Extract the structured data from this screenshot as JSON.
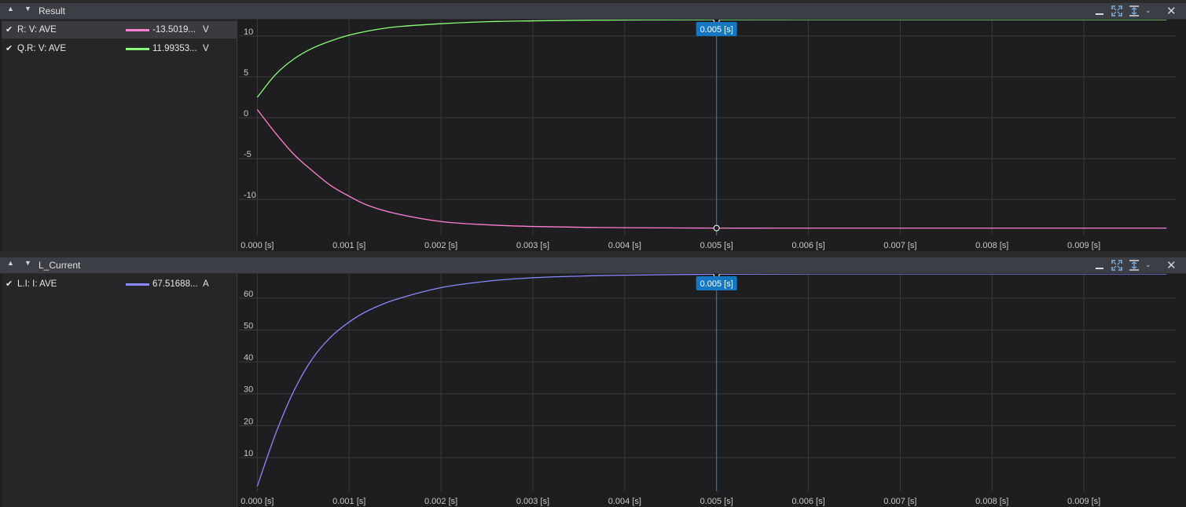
{
  "panels": [
    {
      "title": "Result",
      "legend": [
        {
          "check": "✔",
          "name": "R: V: AVE",
          "value": "-13.5019...",
          "unit": "V",
          "color": "#ff7fd0",
          "selected": true
        },
        {
          "check": "✔",
          "name": "Q.R: V: AVE",
          "value": "11.99353...",
          "unit": "V",
          "color": "#88ff77",
          "selected": false
        }
      ],
      "cursor_label": "0.005 [s]"
    },
    {
      "title": "L_Current",
      "legend": [
        {
          "check": "✔",
          "name": "L.I: I: AVE",
          "value": "67.51688...",
          "unit": "A",
          "color": "#8888ff",
          "selected": false
        }
      ],
      "cursor_label": "0.005 [s]"
    }
  ],
  "colors": {
    "background": "#1e1e20",
    "grid": "#3a3a3e",
    "cursor": "#1e82d2",
    "cursor_label_bg": "#1577c2"
  },
  "chart_data": [
    {
      "type": "line",
      "title": "Result",
      "x_tick_labels": [
        "0.000 [s]",
        "0.001 [s]",
        "0.002 [s]",
        "0.003 [s]",
        "0.004 [s]",
        "0.005 [s]",
        "0.006 [s]",
        "0.007 [s]",
        "0.008 [s]",
        "0.009 [s]"
      ],
      "x_ticks": [
        0,
        0.001,
        0.002,
        0.003,
        0.004,
        0.005,
        0.006,
        0.007,
        0.008,
        0.009
      ],
      "xlim": [
        -0.0002,
        0.01
      ],
      "y_ticks": [
        10,
        5,
        0,
        -5,
        -10
      ],
      "ylim": [
        -14.4,
        12.0
      ],
      "cursor_x": 0.005,
      "series": [
        {
          "name": "R: V: AVE",
          "color": "#ff7fd0",
          "x": [
            0,
            0.0002,
            0.0004,
            0.0006,
            0.0008,
            0.001,
            0.0012,
            0.0015,
            0.002,
            0.0025,
            0.003,
            0.0035,
            0.004,
            0.005,
            0.006,
            0.007,
            0.008,
            0.009,
            0.0099
          ],
          "y": [
            1.0,
            -1.9,
            -4.5,
            -6.5,
            -8.3,
            -9.6,
            -10.7,
            -11.7,
            -12.7,
            -13.1,
            -13.3,
            -13.4,
            -13.45,
            -13.5,
            -13.5,
            -13.5,
            -13.5,
            -13.5,
            -13.5
          ]
        },
        {
          "name": "Q.R: V: AVE",
          "color": "#88ff77",
          "x": [
            0,
            0.0002,
            0.0004,
            0.0006,
            0.0008,
            0.001,
            0.0012,
            0.0015,
            0.002,
            0.0025,
            0.003,
            0.0035,
            0.004,
            0.005,
            0.006,
            0.007,
            0.008,
            0.009,
            0.0099
          ],
          "y": [
            2.5,
            5.3,
            7.2,
            8.5,
            9.4,
            10.1,
            10.6,
            11.1,
            11.5,
            11.75,
            11.85,
            11.92,
            11.95,
            11.99,
            12.0,
            12.0,
            12.0,
            12.0,
            12.0
          ]
        }
      ]
    },
    {
      "type": "line",
      "title": "L_Current",
      "x_tick_labels": [
        "0.000 [s]",
        "0.001 [s]",
        "0.002 [s]",
        "0.003 [s]",
        "0.004 [s]",
        "0.005 [s]",
        "0.006 [s]",
        "0.007 [s]",
        "0.008 [s]",
        "0.009 [s]"
      ],
      "x_ticks": [
        0,
        0.001,
        0.002,
        0.003,
        0.004,
        0.005,
        0.006,
        0.007,
        0.008,
        0.009
      ],
      "xlim": [
        -0.0002,
        0.01
      ],
      "y_ticks": [
        60,
        50,
        40,
        30,
        20,
        10
      ],
      "ylim": [
        -0.6,
        67.6
      ],
      "cursor_x": 0.005,
      "series": [
        {
          "name": "L.I: I: AVE",
          "color": "#8888ff",
          "x": [
            0,
            0.0002,
            0.0004,
            0.0006,
            0.0008,
            0.001,
            0.0012,
            0.0015,
            0.002,
            0.0025,
            0.003,
            0.0035,
            0.004,
            0.005,
            0.006,
            0.007,
            0.008,
            0.009,
            0.0099
          ],
          "y": [
            1.0,
            17.5,
            31.0,
            41.0,
            47.8,
            52.5,
            56.0,
            59.5,
            63.3,
            65.3,
            66.4,
            66.9,
            67.2,
            67.5,
            67.6,
            67.6,
            67.6,
            67.6,
            67.6
          ]
        }
      ]
    }
  ]
}
